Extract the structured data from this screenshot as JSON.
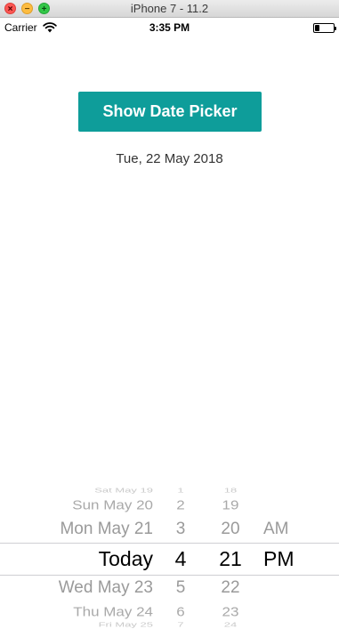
{
  "window": {
    "title": "iPhone 7 - 11.2",
    "close_glyph": "×",
    "minimize_glyph": "−",
    "maximize_glyph": "+"
  },
  "status_bar": {
    "carrier": "Carrier",
    "time": "3:35 PM",
    "wifi_icon": "wifi-icon",
    "battery_icon": "battery-icon",
    "battery_level": 0.25
  },
  "main": {
    "button_label": "Show Date Picker",
    "button_color": "#0e9d9a",
    "selected_date": "Tue, 22 May 2018"
  },
  "picker": {
    "dates": [
      "Sat May 19",
      "Sun May 20",
      "Mon May 21",
      "Today",
      "Wed May 23",
      "Thu May 24",
      "Fri May 25"
    ],
    "hours": [
      "1",
      "2",
      "3",
      "4",
      "5",
      "6",
      "7"
    ],
    "minutes": [
      "18",
      "19",
      "20",
      "21",
      "22",
      "23",
      "24"
    ],
    "ampm": [
      "AM",
      "PM"
    ]
  }
}
